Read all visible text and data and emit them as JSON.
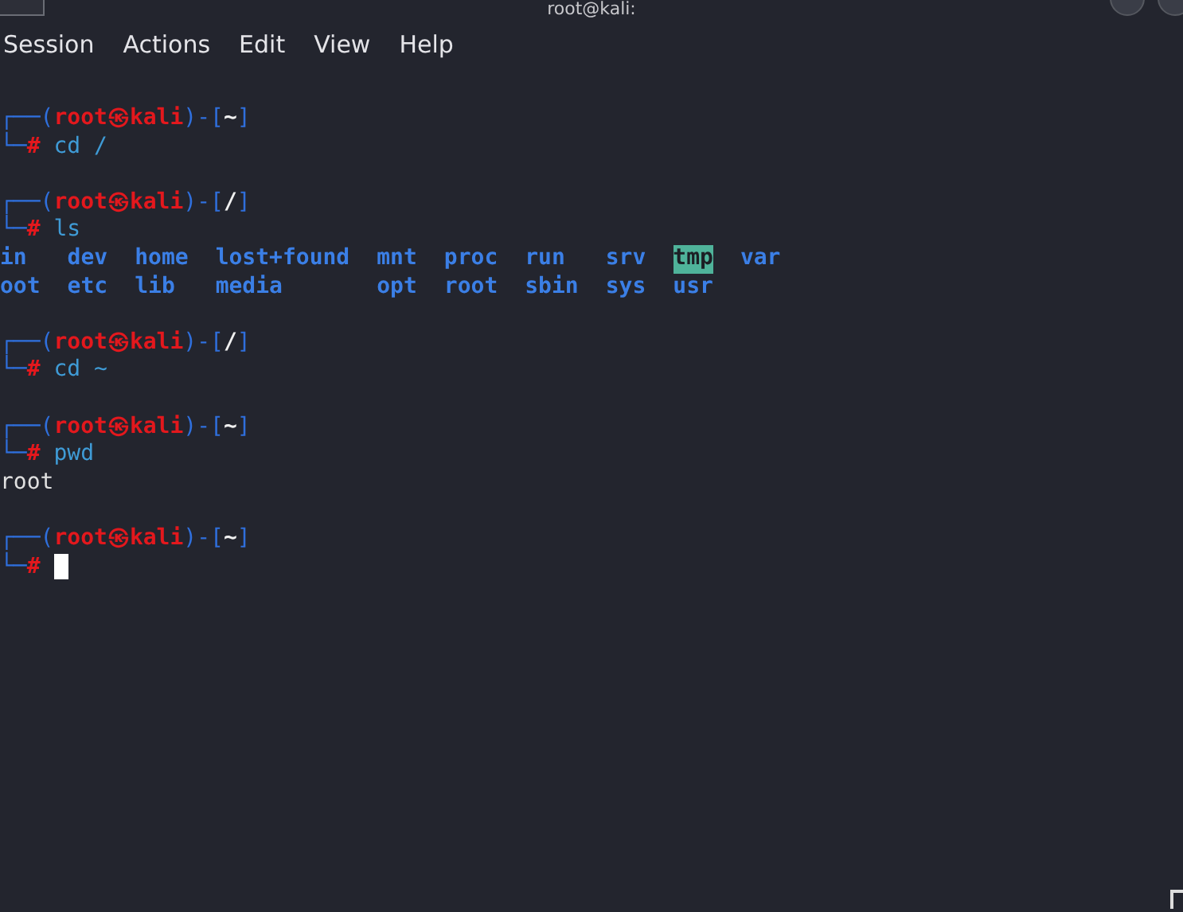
{
  "window": {
    "title": "root@kali:"
  },
  "menu": [
    "Session",
    "Actions",
    "Edit",
    "View",
    "Help"
  ],
  "terminal": {
    "blocks": [
      {
        "prompt": {
          "open": "┌──(",
          "user": "root",
          "at": "㉿",
          "host": "kali",
          "mid": ")-[",
          "cwd": "~",
          "close": "]",
          "corner": "└─",
          "sign": "#",
          "command": "cd /"
        }
      },
      {
        "prompt": {
          "open": "┌──(",
          "user": "root",
          "at": "㉿",
          "host": "kali",
          "mid": ")-[",
          "cwd": "/",
          "close": "]",
          "corner": "└─",
          "sign": "#",
          "command": "ls"
        },
        "output": [
          {
            "kind": "listing",
            "rows": [
              [
                {
                  "name": "in",
                  "kind": "dir"
                },
                {
                  "name": "dev",
                  "kind": "dir"
                },
                {
                  "name": "home",
                  "kind": "dir"
                },
                {
                  "name": "lost+found",
                  "kind": "dir"
                },
                {
                  "name": "mnt",
                  "kind": "dir"
                },
                {
                  "name": "proc",
                  "kind": "dir"
                },
                {
                  "name": "run",
                  "kind": "dir"
                },
                {
                  "name": "srv",
                  "kind": "dir"
                },
                {
                  "name": "tmp",
                  "kind": "sticky"
                },
                {
                  "name": "var",
                  "kind": "dir"
                }
              ],
              [
                {
                  "name": "oot",
                  "kind": "dir"
                },
                {
                  "name": "etc",
                  "kind": "dir"
                },
                {
                  "name": "lib",
                  "kind": "dir"
                },
                {
                  "name": "media",
                  "kind": "dir"
                },
                {
                  "name": "opt",
                  "kind": "dir"
                },
                {
                  "name": "root",
                  "kind": "dir"
                },
                {
                  "name": "sbin",
                  "kind": "dir"
                },
                {
                  "name": "sys",
                  "kind": "dir"
                },
                {
                  "name": "usr",
                  "kind": "dir"
                }
              ]
            ]
          }
        ]
      },
      {
        "prompt": {
          "open": "┌──(",
          "user": "root",
          "at": "㉿",
          "host": "kali",
          "mid": ")-[",
          "cwd": "/",
          "close": "]",
          "corner": "└─",
          "sign": "#",
          "command": "cd ~"
        }
      },
      {
        "prompt": {
          "open": "┌──(",
          "user": "root",
          "at": "㉿",
          "host": "kali",
          "mid": ")-[",
          "cwd": "~",
          "close": "]",
          "corner": "└─",
          "sign": "#",
          "command": "pwd"
        },
        "output": [
          {
            "kind": "text",
            "text": "root"
          }
        ]
      },
      {
        "prompt": {
          "open": "┌──(",
          "user": "root",
          "at": "㉿",
          "host": "kali",
          "mid": ")-[",
          "cwd": "~",
          "close": "]",
          "corner": "└─",
          "sign": "#"
        },
        "cursor": true
      }
    ]
  }
}
